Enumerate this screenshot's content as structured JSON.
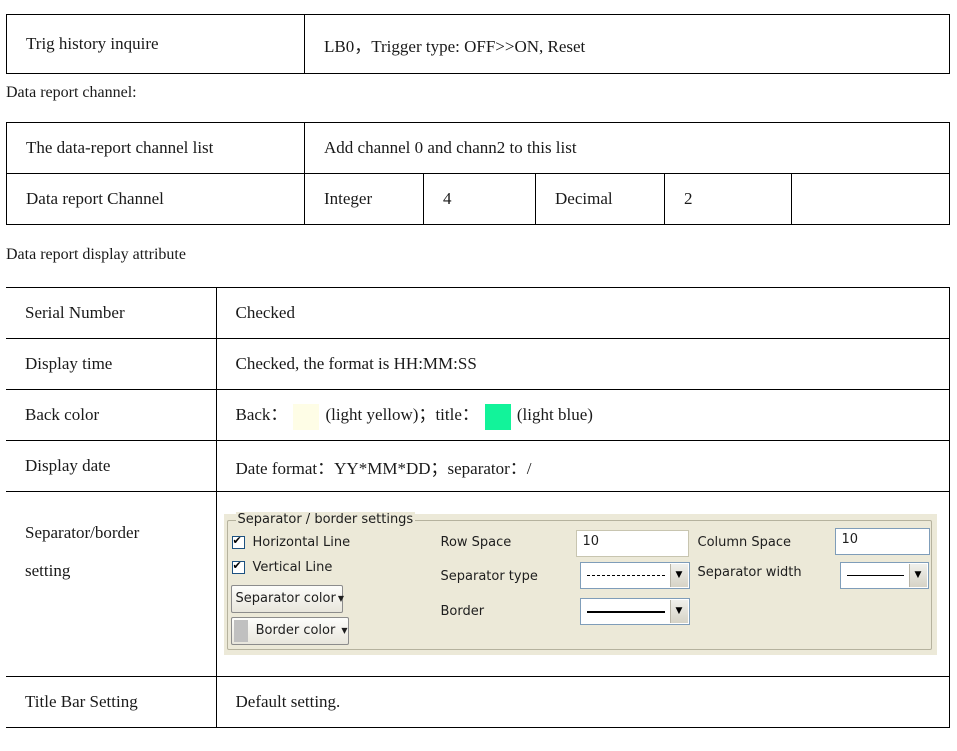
{
  "trig_row": {
    "label": "Trig history inquire",
    "value": "LB0，Trigger type: OFF>>ON, Reset"
  },
  "channel_section": {
    "caption": "Data report channel:",
    "list_label": "The data-report channel list",
    "list_value": "Add channel 0 and chann2 to this list",
    "channel_label": "Data report Channel",
    "integer_label": "Integer",
    "integer_value": "4",
    "decimal_label": "Decimal",
    "decimal_value": "2"
  },
  "display_section": {
    "caption": "Data report display attribute",
    "rows": [
      {
        "label": "Serial Number",
        "value": "Checked"
      },
      {
        "label": "Display time",
        "value": "Checked, the format is HH:MM:SS"
      },
      {
        "label": "Back color",
        "back_prefix": "Back：",
        "back_note": "(light yellow)；title：",
        "title_note": "(light blue)"
      },
      {
        "label": "Display date",
        "value": "Date format：YY*MM*DD；separator：/"
      },
      {
        "label_line1": "Separator/border",
        "label_line2": "setting"
      },
      {
        "label": "Title Bar Setting",
        "value": "Default setting."
      }
    ],
    "colors": {
      "back": "#fefde6",
      "title": "#12f39a"
    }
  },
  "dialog": {
    "legend": "Separator / border settings",
    "horizontal_line": "Horizontal Line",
    "vertical_line": "Vertical Line",
    "separator_color_btn": "Separator color",
    "border_color_btn": "Border color",
    "row_space_label": "Row Space",
    "row_space_value": "10",
    "column_space_label": "Column Space",
    "column_space_value": "10",
    "separator_type_label": "Separator type",
    "separator_width_label": "Separator width",
    "border_label": "Border",
    "colors": {
      "separator": "#000000",
      "border": "#c0c0c0"
    }
  }
}
